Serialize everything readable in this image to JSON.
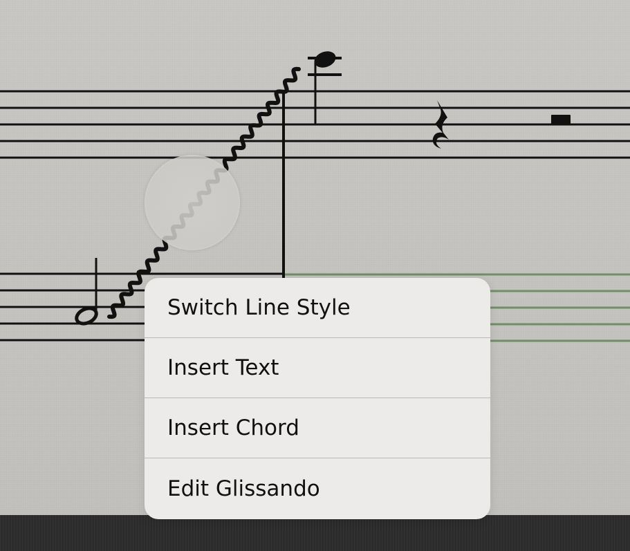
{
  "colors": {
    "paper": "#c7c5c1",
    "staff_line": "#111111",
    "selected_staff_line": "#6f8f64",
    "menu_background": "#ecebe9",
    "menu_separator": "#b9b8b6",
    "bottom_toolbar": "#2b2b2c"
  },
  "score": {
    "elements": [
      "upper-staff",
      "lower-staff",
      "half-note",
      "glissando-line",
      "barline",
      "high-note",
      "quarter-rest",
      "whole-rest"
    ]
  },
  "context_menu": {
    "items": [
      {
        "label": "Switch Line Style"
      },
      {
        "label": "Insert Text"
      },
      {
        "label": "Insert Chord"
      },
      {
        "label": "Edit Glissando"
      }
    ]
  }
}
